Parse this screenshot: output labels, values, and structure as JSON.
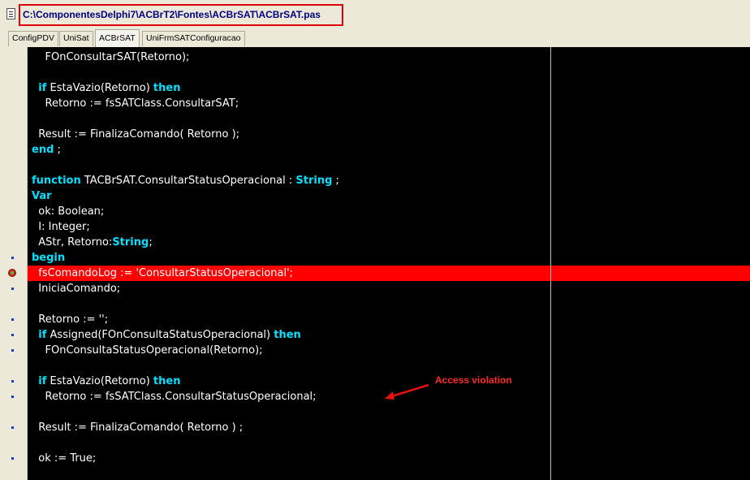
{
  "window": {
    "title": "C:\\ComponentesDelphi7\\ACBrT2\\Fontes\\ACBrSAT\\ACBrSAT.pas",
    "file_icon": "document-icon"
  },
  "tabs": [
    {
      "label": "ConfigPDV",
      "active": false
    },
    {
      "label": "UniSat",
      "active": false
    },
    {
      "label": "ACBrSAT",
      "active": true
    },
    {
      "label": "UniFrmSATConfiguracao",
      "active": false
    }
  ],
  "colors": {
    "editor_background": "#000000",
    "keyword": "#00e0ff",
    "text": "#ffffff",
    "error_line": "#ff0000",
    "annotation": "#ff2a2a",
    "title_highlight": "#e0000c"
  },
  "code": {
    "lines": [
      {
        "indent": "    ",
        "kw": "",
        "text": "FOnConsultarSAT(Retorno);",
        "kw2": "",
        "text2": ""
      },
      {
        "indent": "",
        "kw": "",
        "text": "",
        "kw2": "",
        "text2": ""
      },
      {
        "indent": "  ",
        "kw": "if",
        "text": " EstaVazio(Retorno) ",
        "kw2": "then",
        "text2": ""
      },
      {
        "indent": "    ",
        "kw": "",
        "text": "Retorno := fsSATClass.ConsultarSAT;",
        "kw2": "",
        "text2": ""
      },
      {
        "indent": "",
        "kw": "",
        "text": "",
        "kw2": "",
        "text2": ""
      },
      {
        "indent": "  ",
        "kw": "",
        "text": "Result := FinalizaComando( Retorno );",
        "kw2": "",
        "text2": ""
      },
      {
        "indent": "",
        "kw": "end",
        "text": " ;",
        "kw2": "",
        "text2": ""
      },
      {
        "indent": "",
        "kw": "",
        "text": "",
        "kw2": "",
        "text2": ""
      },
      {
        "indent": "",
        "kw": "function",
        "text": " TACBrSAT.ConsultarStatusOperacional : ",
        "kw2": "String",
        "text2": " ;"
      },
      {
        "indent": "",
        "kw": "Var",
        "text": "",
        "kw2": "",
        "text2": ""
      },
      {
        "indent": "  ",
        "kw": "",
        "text": "ok: Boolean;",
        "kw2": "",
        "text2": ""
      },
      {
        "indent": "  ",
        "kw": "",
        "text": "I: Integer;",
        "kw2": "",
        "text2": ""
      },
      {
        "indent": "  ",
        "kw": "",
        "text": "AStr, Retorno:",
        "kw2": "String",
        "text2": ";"
      },
      {
        "indent": "",
        "kw": "begin",
        "text": "",
        "kw2": "",
        "text2": ""
      },
      {
        "indent": "  ",
        "kw": "",
        "text": "fsComandoLog := 'ConsultarStatusOperacional';",
        "kw2": "",
        "text2": ""
      },
      {
        "indent": "  ",
        "kw": "",
        "text": "IniciaComando;",
        "kw2": "",
        "text2": ""
      },
      {
        "indent": "",
        "kw": "",
        "text": "",
        "kw2": "",
        "text2": ""
      },
      {
        "indent": "  ",
        "kw": "",
        "text": "Retorno := '';",
        "kw2": "",
        "text2": ""
      },
      {
        "indent": "  ",
        "kw": "if",
        "text": " Assigned(FOnConsultaStatusOperacional) ",
        "kw2": "then",
        "text2": ""
      },
      {
        "indent": "    ",
        "kw": "",
        "text": "FOnConsultaStatusOperacional(Retorno);",
        "kw2": "",
        "text2": ""
      },
      {
        "indent": "",
        "kw": "",
        "text": "",
        "kw2": "",
        "text2": ""
      },
      {
        "indent": "  ",
        "kw": "if",
        "text": " EstaVazio(Retorno) ",
        "kw2": "then",
        "text2": ""
      },
      {
        "indent": "    ",
        "kw": "",
        "text": "Retorno := fsSATClass.ConsultarStatusOperacional;",
        "kw2": "",
        "text2": ""
      },
      {
        "indent": "",
        "kw": "",
        "text": "",
        "kw2": "",
        "text2": ""
      },
      {
        "indent": "  ",
        "kw": "",
        "text": "Result := FinalizaComando( Retorno ) ;",
        "kw2": "",
        "text2": ""
      },
      {
        "indent": "",
        "kw": "",
        "text": "",
        "kw2": "",
        "text2": ""
      },
      {
        "indent": "  ",
        "kw": "",
        "text": "ok := True;",
        "kw2": "",
        "text2": ""
      }
    ],
    "breakpoint_line_index": 14,
    "gutter_dot_line_indexes": [
      13,
      15,
      17,
      18,
      19,
      21,
      22,
      24,
      26
    ]
  },
  "annotation": {
    "text": "Access violation",
    "arrow_icon": "red-arrow-left-icon"
  }
}
